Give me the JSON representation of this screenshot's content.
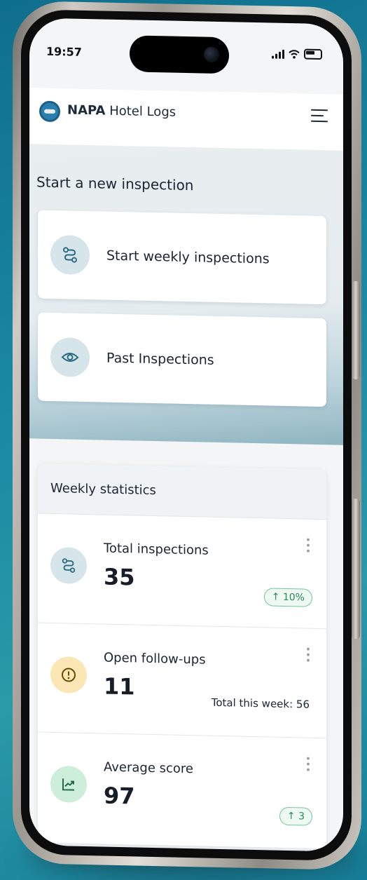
{
  "status_bar": {
    "time": "19:57"
  },
  "header": {
    "brand_bold": "NAPA",
    "brand_rest": " Hotel Logs"
  },
  "hero": {
    "title": "Start a new inspection",
    "actions": [
      {
        "label": "Start weekly inspections",
        "icon": "route-icon"
      },
      {
        "label": "Past Inspections",
        "icon": "eye-icon"
      }
    ]
  },
  "stats": {
    "title": "Weekly statistics",
    "items": [
      {
        "label": "Total inspections",
        "value": "35",
        "badge": "↑ 10%",
        "icon": "route-icon",
        "icon_bg": "#d6e5ea"
      },
      {
        "label": "Open follow-ups",
        "value": "11",
        "subtext": "Total this week: 56",
        "icon": "alert-circle-icon",
        "icon_bg": "#fbe7b5"
      },
      {
        "label": "Average score",
        "value": "97",
        "badge": "↑ 3",
        "icon": "trend-up-icon",
        "icon_bg": "#cdeed8"
      }
    ]
  },
  "colors": {
    "accent": "#2a7fae",
    "positive": "#2c8a58"
  }
}
